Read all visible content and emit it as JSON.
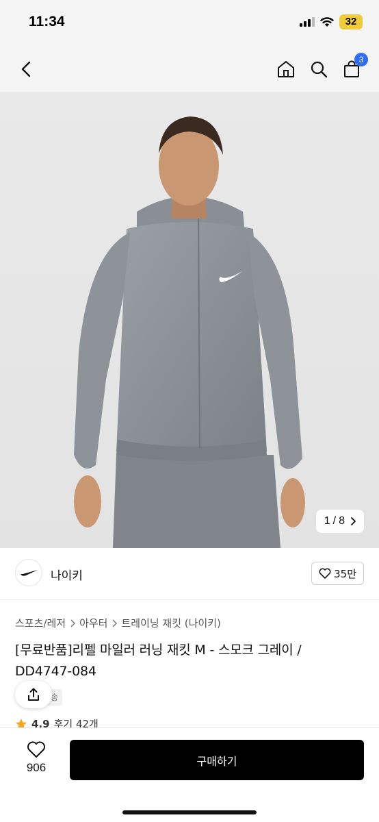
{
  "status": {
    "time": "11:34",
    "battery": "32"
  },
  "nav": {
    "cart_count": "3"
  },
  "gallery": {
    "current": "1",
    "separator": "/",
    "total": "8"
  },
  "brand": {
    "name": "나이키",
    "likes": "35만"
  },
  "breadcrumb": {
    "items": [
      "스포츠/레저",
      "아우터",
      "트레이닝 재킷 (나이키)"
    ]
  },
  "product": {
    "title_line1": "[무료반품]리펠 마일러 러닝 재킷 M - 스모크 그레이 /",
    "title_line2": "DD4747-084",
    "tag_partial": "송"
  },
  "rating": {
    "score": "4.9",
    "reviews": "후기 42개"
  },
  "bottom": {
    "wish_count": "906",
    "buy_label": "구매하기"
  },
  "colors": {
    "accent": "#2f6df6",
    "buy_bg": "#000000",
    "star": "#f5a623",
    "battery": "#f2cb3a"
  },
  "icons": [
    "back-chevron-icon",
    "home-icon",
    "search-icon",
    "shopping-bag-icon",
    "nike-swoosh-icon",
    "heart-icon",
    "share-icon",
    "star-icon"
  ]
}
